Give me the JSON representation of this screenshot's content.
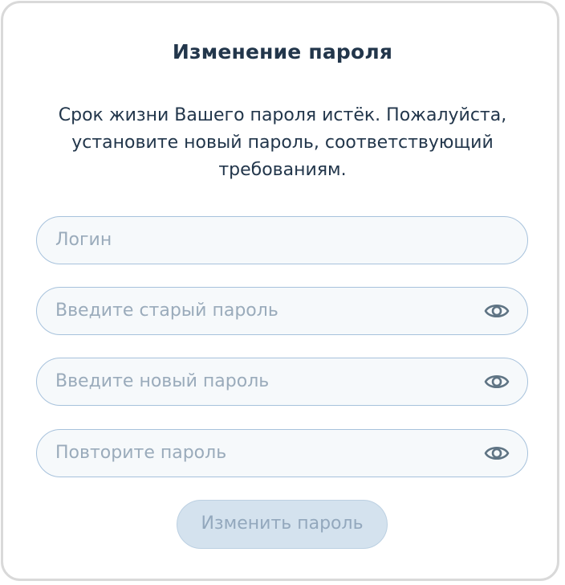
{
  "dialog": {
    "title": "Изменение пароля",
    "description": "Срок жизни Вашего пароля истёк. Пожалуйста, установите новый пароль, соответствующий требованиям."
  },
  "fields": {
    "login": {
      "placeholder": "Логин",
      "value": ""
    },
    "old_password": {
      "placeholder": "Введите старый пароль",
      "value": "",
      "icon": "eye-icon"
    },
    "new_password": {
      "placeholder": "Введите новый пароль",
      "value": "",
      "icon": "eye-icon"
    },
    "repeat_password": {
      "placeholder": "Повторите пароль",
      "value": "",
      "icon": "eye-icon"
    }
  },
  "submit": {
    "label": "Изменить пароль",
    "state": "disabled"
  },
  "colors": {
    "text": "#22364b",
    "field_border": "#a7c2dc",
    "field_bg": "#f6f9fb",
    "placeholder": "#9aabbb",
    "button_bg_disabled": "#d4e2ee",
    "button_text_disabled": "#93a8bd",
    "icon": "#5f7484"
  }
}
